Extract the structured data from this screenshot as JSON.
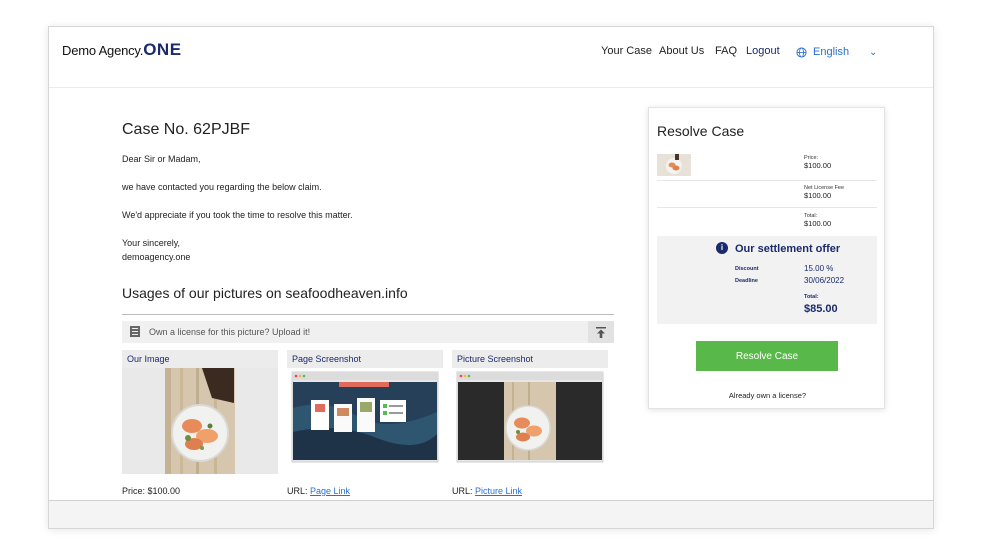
{
  "header": {
    "logo_text": "Demo Agency.",
    "logo_brand": "ONE",
    "nav": {
      "your_case": "Your Case",
      "about_us": "About Us",
      "faq": "FAQ",
      "logout": "Logout"
    },
    "language": "English",
    "language_icon": "globe-icon",
    "dropdown_icon": "chevron-down-icon"
  },
  "case": {
    "title": "Case No. 62PJBF",
    "greeting": "Dear Sir or Madam,",
    "line1": "we have contacted you regarding the below claim.",
    "line2": "We'd appreciate if you took the time to resolve this matter.",
    "closing": "Your sincerely,",
    "signature": "demoagency.one"
  },
  "usages": {
    "title": "Usages of our pictures on seafoodheaven.info",
    "upload_text": "Own a license for this picture? Upload it!",
    "columns": {
      "our_image": "Our Image",
      "page_screenshot": "Page Screenshot",
      "picture_screenshot": "Picture Screenshot"
    },
    "price_text": "Price: $100.00",
    "url_label": "URL:",
    "page_link": "Page Link",
    "picture_link": "Picture Link"
  },
  "resolve": {
    "title": "Resolve Case",
    "price_label": "Price:",
    "price_value": "$100.00",
    "net_fee_label": "Net License Fee",
    "net_fee_value": "$100.00",
    "total_label": "Total:",
    "total_value": "$100.00",
    "offer": {
      "title": "Our settlement offer",
      "discount_label": "Discount",
      "discount_value": "15.00 %",
      "deadline_label": "Deadline",
      "deadline_value": "30/06/2022",
      "total_label": "Total:",
      "total_value": "$85.00"
    },
    "button": "Resolve Case",
    "already_link": "Already own a license?"
  },
  "colors": {
    "brand": "#1b2a6b",
    "link": "#2a6fd1",
    "resolve_button": "#59b84a"
  }
}
